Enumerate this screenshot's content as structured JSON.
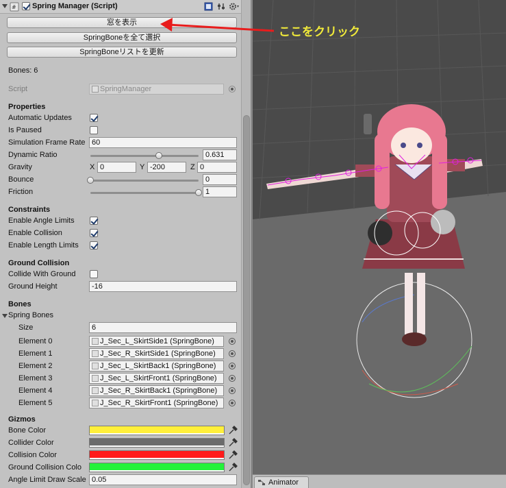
{
  "component": {
    "title": "Spring Manager (Script)"
  },
  "buttons": {
    "show_window": "窓を表示",
    "select_all_bones": "SpringBoneを全て選択",
    "refresh_bone_list": "SpringBoneリストを更新"
  },
  "bones_count": "Bones: 6",
  "script": {
    "label": "Script",
    "value": "SpringManager"
  },
  "properties": {
    "heading": "Properties",
    "automatic_updates": {
      "label": "Automatic Updates",
      "checked": true
    },
    "is_paused": {
      "label": "Is Paused",
      "checked": false
    },
    "simulation_frame_rate": {
      "label": "Simulation Frame Rate",
      "value": "60"
    },
    "dynamic_ratio": {
      "label": "Dynamic Ratio",
      "value": "0.631",
      "fraction": 0.631
    },
    "gravity": {
      "label": "Gravity",
      "x_label": "X",
      "x": "0",
      "y_label": "Y",
      "y": "-200",
      "z_label": "Z",
      "z": "0"
    },
    "bounce": {
      "label": "Bounce",
      "value": "0",
      "fraction": 0.0
    },
    "friction": {
      "label": "Friction",
      "value": "1",
      "fraction": 1.0
    }
  },
  "constraints": {
    "heading": "Constraints",
    "enable_angle_limits": {
      "label": "Enable Angle Limits",
      "checked": true
    },
    "enable_collision": {
      "label": "Enable Collision",
      "checked": true
    },
    "enable_length_limits": {
      "label": "Enable Length Limits",
      "checked": true
    }
  },
  "ground_collision": {
    "heading": "Ground Collision",
    "collide_with_ground": {
      "label": "Collide With Ground",
      "checked": false
    },
    "ground_height": {
      "label": "Ground Height",
      "value": "-16"
    }
  },
  "bones": {
    "heading": "Bones",
    "spring_bones_label": "Spring Bones",
    "size_label": "Size",
    "size": "6",
    "elements": [
      {
        "label": "Element 0",
        "value": "J_Sec_L_SkirtSide1 (SpringBone)"
      },
      {
        "label": "Element 1",
        "value": "J_Sec_R_SkirtSide1 (SpringBone)"
      },
      {
        "label": "Element 2",
        "value": "J_Sec_L_SkirtBack1 (SpringBone)"
      },
      {
        "label": "Element 3",
        "value": "J_Sec_L_SkirtFront1 (SpringBone)"
      },
      {
        "label": "Element 4",
        "value": "J_Sec_R_SkirtBack1 (SpringBone)"
      },
      {
        "label": "Element 5",
        "value": "J_Sec_R_SkirtFront1 (SpringBone)"
      }
    ]
  },
  "gizmos": {
    "heading": "Gizmos",
    "bone_color": {
      "label": "Bone Color",
      "color": "#ffef3a"
    },
    "collider_color": {
      "label": "Collider Color",
      "color": "#6b6b6b"
    },
    "collision_color": {
      "label": "Collision Color",
      "color": "#ff1b1b"
    },
    "ground_collision_color": {
      "label": "Ground Collision Colo",
      "color": "#23f23a"
    },
    "angle_limit_draw_scale": {
      "label": "Angle Limit Draw Scale",
      "value": "0.05"
    }
  },
  "annotation": {
    "text": "ここをクリック",
    "color": "#f1ea3a",
    "arrow_color": "#e81c1c"
  },
  "scene": {
    "tab_label": "Animator"
  }
}
